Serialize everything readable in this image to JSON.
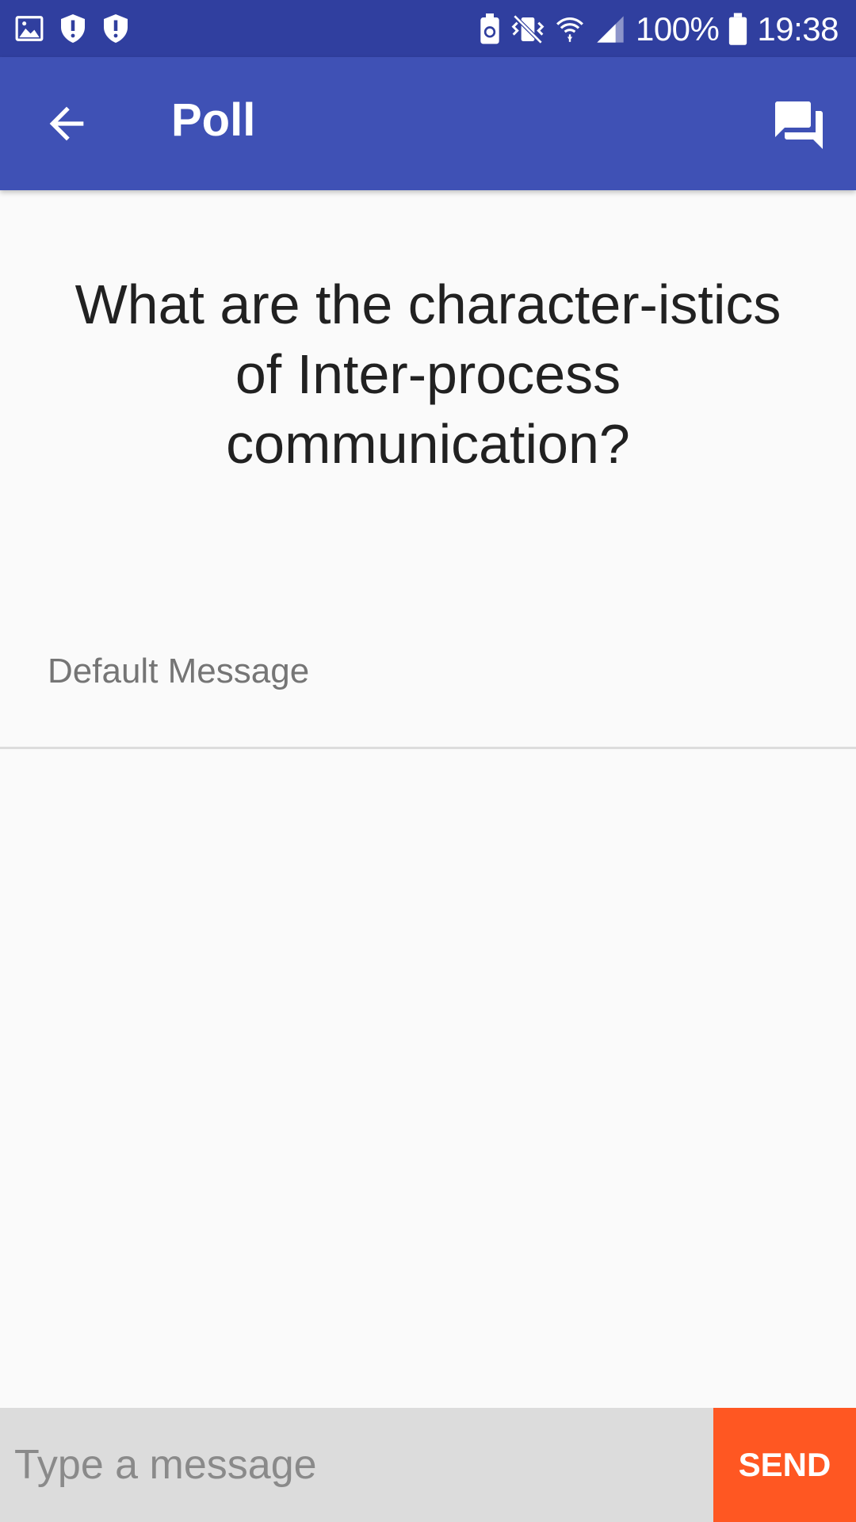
{
  "status_bar": {
    "left_icons": [
      "gallery-icon",
      "shield-icon",
      "shield-icon"
    ],
    "right_icons": [
      "battery-saver-icon",
      "vibrate-mute-icon",
      "wifi-icon",
      "signal-icon",
      "battery-icon"
    ],
    "battery": "100%",
    "time": "19:38"
  },
  "app_bar": {
    "title": "Poll",
    "back_icon": "arrow-back-icon",
    "action_icon": "chat-bubbles-icon"
  },
  "poll": {
    "question": "What are the character-istics of Inter-process communication?",
    "default_message": "Default Message"
  },
  "composer": {
    "placeholder": "Type a message",
    "value": "",
    "send_label": "SEND"
  },
  "colors": {
    "status_bar": "#303f9f",
    "app_bar": "#3f51b5",
    "send_button": "#ff5722",
    "background": "#fafafa",
    "input_background": "#dcdcdc"
  }
}
